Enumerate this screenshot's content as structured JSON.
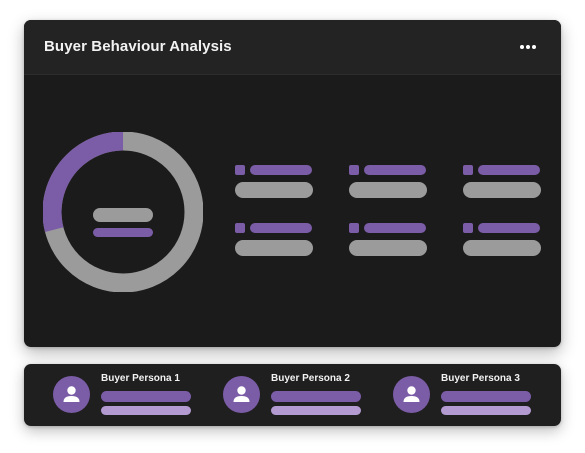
{
  "header": {
    "title": "Buyer Behaviour Analysis"
  },
  "donut": {
    "highlight_share": 0.29,
    "colors": {
      "highlight": "#7b5ca7",
      "track": "#9b9b9b"
    }
  },
  "personas": [
    {
      "name": "Buyer Persona 1"
    },
    {
      "name": "Buyer Persona 2"
    },
    {
      "name": "Buyer Persona 3"
    }
  ],
  "colors": {
    "accent": "#7b5ca7",
    "accent_light": "#b39ad0",
    "placeholder_gray": "#9b9b9b",
    "card_bg": "#1b1b1b",
    "header_bg": "#232323"
  }
}
